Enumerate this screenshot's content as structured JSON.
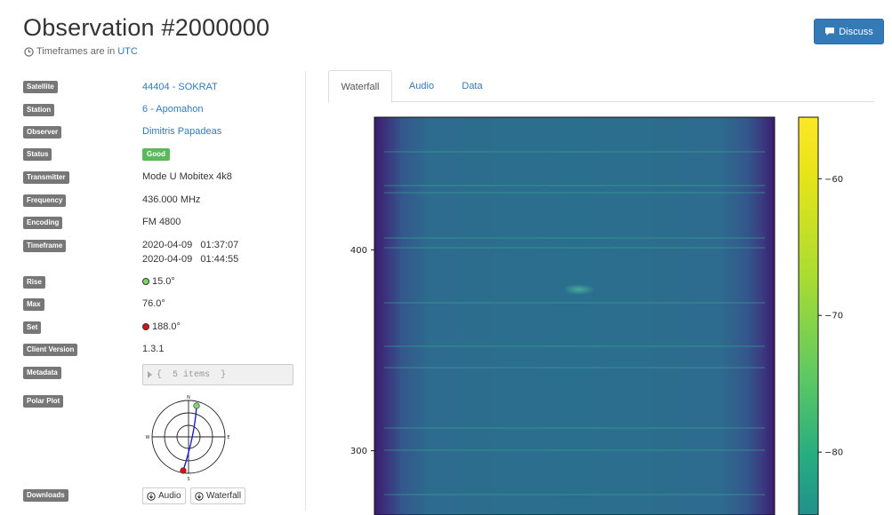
{
  "page": {
    "title": "Observation #2000000",
    "timeframe_note": "Timeframes are in",
    "timeframe_zone": "UTC",
    "discuss_label": "Discuss"
  },
  "details": {
    "satellite": {
      "label": "Satellite",
      "value": "44404 - SOKRAT"
    },
    "station": {
      "label": "Station",
      "value": "6 - Apomahon"
    },
    "observer": {
      "label": "Observer",
      "value": "Dimitris Papadeas"
    },
    "status": {
      "label": "Status",
      "value": "Good"
    },
    "transmitter": {
      "label": "Transmitter",
      "value": "Mode U Mobitex 4k8"
    },
    "frequency": {
      "label": "Frequency",
      "value": "436.000 MHz"
    },
    "encoding": {
      "label": "Encoding",
      "value": "FM 4800"
    },
    "timeframe": {
      "label": "Timeframe",
      "start": "2020-04-09   01:37:07",
      "end": "2020-04-09   01:44:55"
    },
    "rise": {
      "label": "Rise",
      "value": "15.0°"
    },
    "max": {
      "label": "Max",
      "value": "76.0°"
    },
    "set": {
      "label": "Set",
      "value": "188.0°"
    },
    "client_version": {
      "label": "Client Version",
      "value": "1.3.1"
    },
    "metadata": {
      "label": "Metadata",
      "value": "{  5 items  }"
    },
    "polar_plot": {
      "label": "Polar Plot",
      "n": "N",
      "e": "E",
      "s": "S",
      "w": "W"
    },
    "downloads": {
      "label": "Downloads",
      "audio": "Audio",
      "waterfall": "Waterfall"
    }
  },
  "tabs": [
    {
      "label": "Waterfall",
      "active": true
    },
    {
      "label": "Audio",
      "active": false
    },
    {
      "label": "Data",
      "active": false
    }
  ],
  "icons": {
    "clock": "clock-icon",
    "discuss": "comment-icon",
    "metadata_toggle": "caret-right-icon",
    "download": "download-icon"
  },
  "colors": {
    "primary": "#337ab7",
    "label_bg": "#777777",
    "good": "#5cb85c",
    "rise_dot": "#7cd66a",
    "set_dot": "#e01010",
    "track": "#1a1adf"
  },
  "chart_data": {
    "type": "heatmap",
    "y_ticks": [
      {
        "value": 400,
        "label": "400"
      },
      {
        "value": 300,
        "label": "300"
      }
    ],
    "colorbar": {
      "ticks": [
        {
          "value": -60,
          "label": "−60"
        },
        {
          "value": -70,
          "label": "−70"
        },
        {
          "value": -80,
          "label": "−80"
        }
      ],
      "colormap": "viridis"
    },
    "visible_y_range": [
      268,
      466
    ],
    "visible_colorbar_range": [
      -84.6,
      -55.5
    ]
  }
}
